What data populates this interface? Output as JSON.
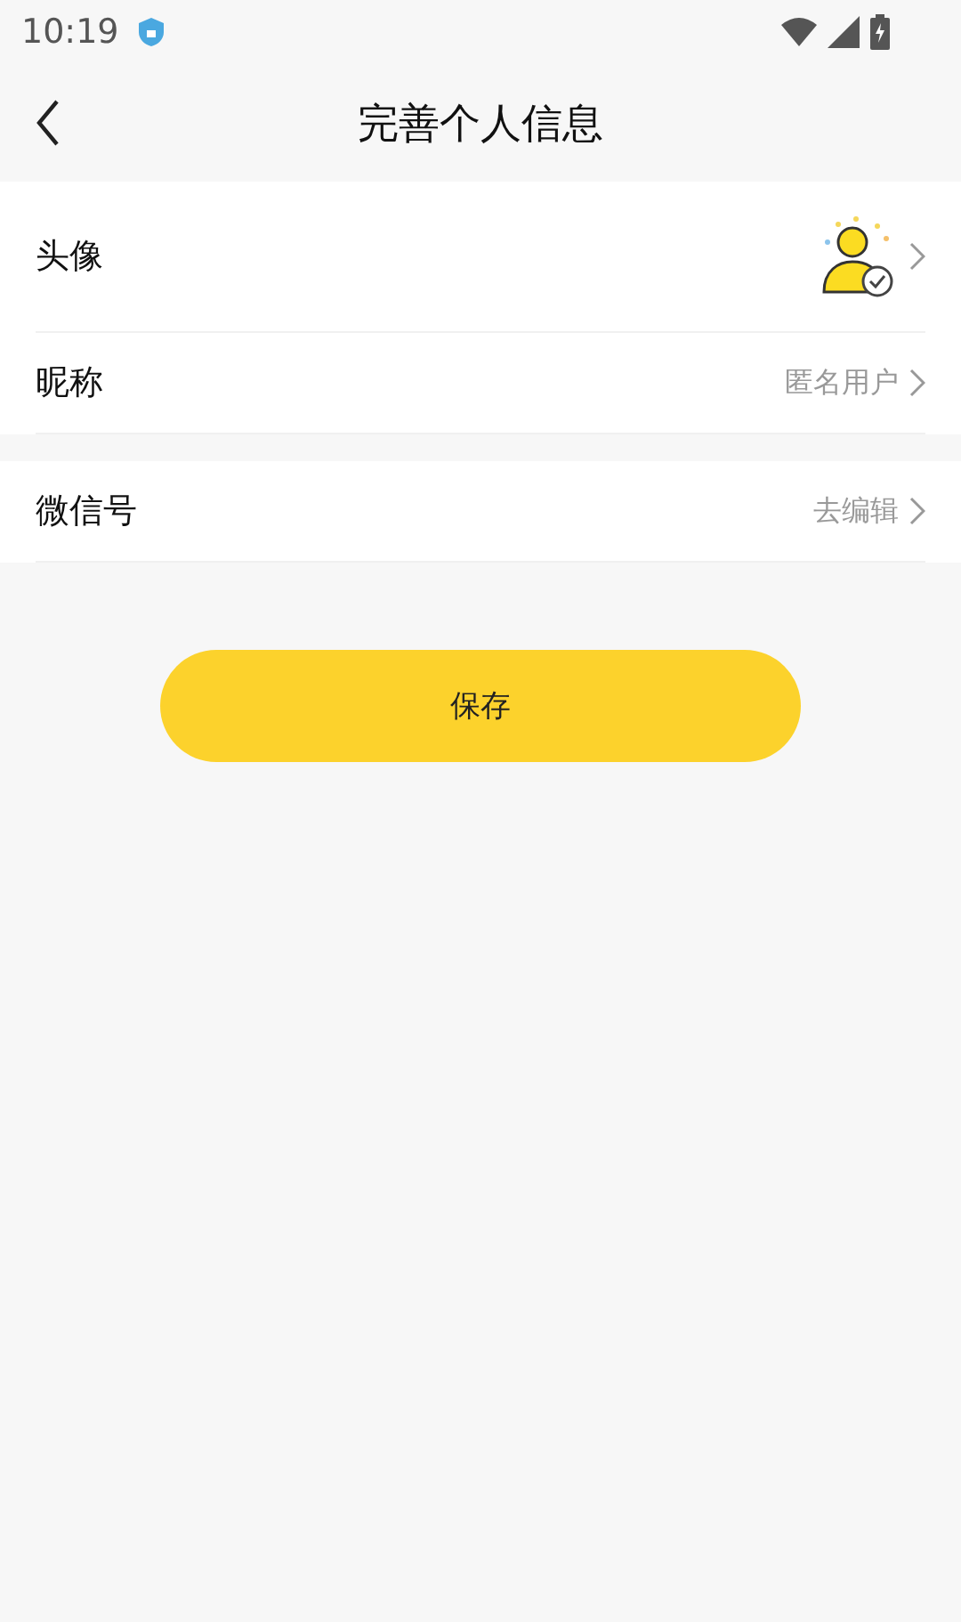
{
  "status_bar": {
    "time": "10:19"
  },
  "header": {
    "title": "完善个人信息"
  },
  "groups": [
    {
      "rows": [
        {
          "kind": "avatar",
          "label": "头像"
        },
        {
          "kind": "text",
          "label": "昵称",
          "value": "匿名用户"
        }
      ]
    },
    {
      "rows": [
        {
          "kind": "text",
          "label": "微信号",
          "value": "去编辑"
        }
      ]
    }
  ],
  "save_button": "保存"
}
